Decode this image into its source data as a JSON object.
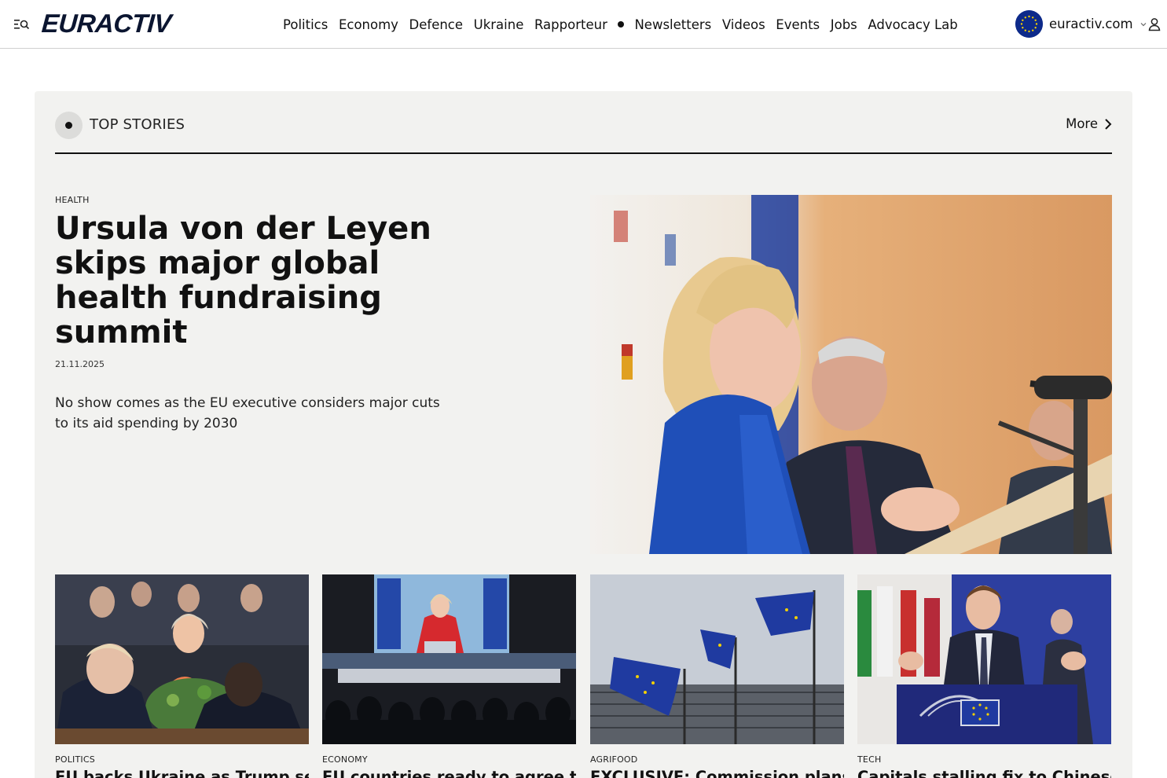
{
  "header": {
    "logo": "EURACTIV",
    "nav": [
      "Politics",
      "Economy",
      "Defence",
      "Ukraine",
      "Rapporteur"
    ],
    "nav2": [
      "Newsletters",
      "Videos",
      "Events",
      "Jobs",
      "Advocacy Lab"
    ],
    "region": "euractiv.com"
  },
  "top_stories": {
    "title": "TOP STORIES",
    "more": "More",
    "lead": {
      "category": "HEALTH",
      "title": "Ursula von der Leyen skips major global health fundraising summit",
      "date": "21.11.2025",
      "description": "No show comes as the EU executive considers major cuts to its aid spending by 2030"
    },
    "cards": [
      {
        "category": "POLITICS",
        "title": "EU backs Ukraine as Trump sets"
      },
      {
        "category": "ECONOMY",
        "title": "EU countries ready to agree to"
      },
      {
        "category": "AGRIFOOD",
        "title": "EXCLUSIVE: Commission plans"
      },
      {
        "category": "TECH",
        "title": "Capitals stalling fix to Chinese"
      }
    ]
  },
  "colors": {
    "brand": "#0b1530",
    "eu_blue": "#0d2a8a",
    "panel_bg": "#f2f2f0"
  }
}
